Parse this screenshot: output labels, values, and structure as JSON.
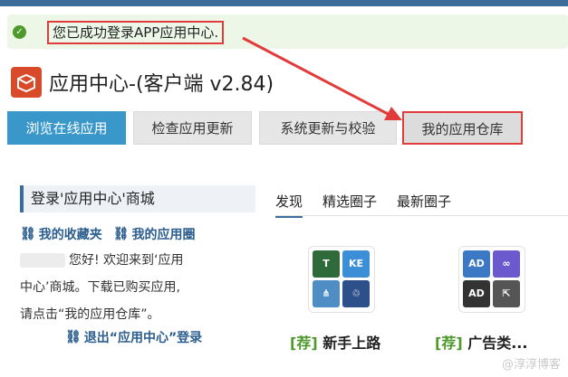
{
  "notice": {
    "icon": "check-circle-icon",
    "message": "您已成功登录APP应用中心."
  },
  "app": {
    "logo_icon": "box-logo-icon",
    "title": "应用中心-(客户端 v2.84)"
  },
  "tabs": [
    {
      "label": "浏览在线应用",
      "active": true
    },
    {
      "label": "检查应用更新",
      "active": false
    },
    {
      "label": "系统更新与校验",
      "active": false
    },
    {
      "label": "我的应用仓库",
      "active": false,
      "highlighted": true
    }
  ],
  "left": {
    "heading": "登录'应用中心'商城",
    "links": [
      {
        "icon": "link-icon",
        "label": "我的收藏夹"
      },
      {
        "icon": "link-icon",
        "label": "我的应用圈"
      }
    ],
    "welcome_line1": "您好! 欢迎来到‘应用",
    "welcome_line2": "中心’商城。下载已购买应用,",
    "welcome_line3": "请点击“我的应用仓库”。",
    "logout": {
      "icon": "link-icon",
      "label": "退出“应用中心”登录"
    }
  },
  "right": {
    "tabs": [
      {
        "label": "发现",
        "active": true
      },
      {
        "label": "精选圈子",
        "active": false
      },
      {
        "label": "最新圈子",
        "active": false
      }
    ],
    "cards": [
      {
        "tag": "[荐]",
        "name": "新手上路",
        "icons": [
          "T",
          "KE",
          "⋔",
          "♲"
        ]
      },
      {
        "tag": "[荐]",
        "name": "广告类...",
        "icons": [
          "AD",
          "∞",
          "AD",
          "⇱"
        ]
      }
    ]
  },
  "watermark": "@淳淳博客",
  "colors": {
    "accent": "#3a97c9",
    "highlight": "#e23b3b",
    "success": "#4c9a2a",
    "link": "#2b5d8e"
  }
}
